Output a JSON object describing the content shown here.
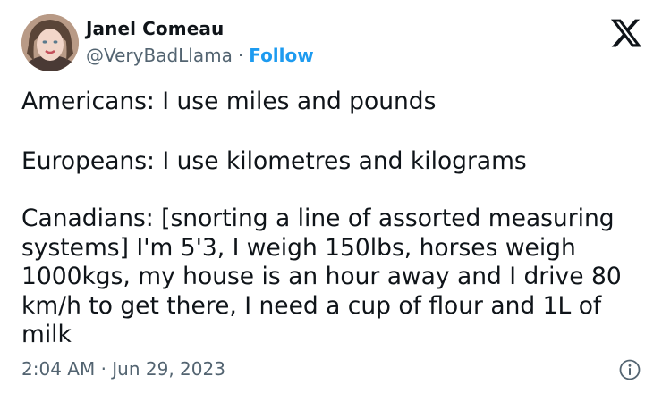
{
  "author": {
    "name": "Janel Comeau",
    "handle": "@VeryBadLlama",
    "separator": "·",
    "follow_label": "Follow"
  },
  "brand": {
    "logo_icon": "x-logo-icon"
  },
  "tweet": {
    "paragraphs": [
      "Americans: I use miles and pounds",
      "Europeans: I use kilometres and kilograms",
      "Canadians: [snorting a line of assorted measuring systems] I'm 5'3, I weigh 150lbs, horses weigh 1000kgs, my house is an hour away and I drive 80 km/h to get there, I need a cup of flour and 1L of milk"
    ],
    "lines_p3": [
      "Canadians: [snorting a line of assorted measuring",
      "systems] I'm 5'3, I weigh 150lbs, horses weigh",
      "1000kgs, my house is an hour away and I drive 80",
      "km/h to get there, I need a cup of flour and 1L of",
      "milk"
    ]
  },
  "meta": {
    "timestamp": "2:04 AM · Jun 29, 2023",
    "info_icon": "info-icon"
  },
  "colors": {
    "follow": "#1d9bf0",
    "text": "#0f1419",
    "muted": "#536471"
  }
}
